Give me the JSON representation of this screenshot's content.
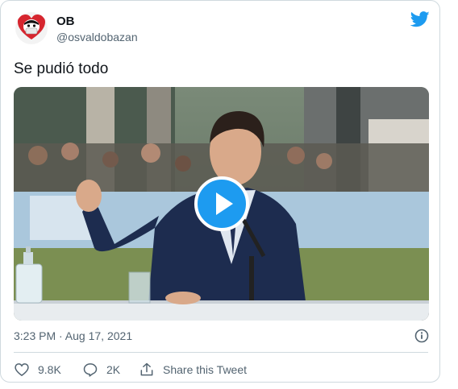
{
  "tweet": {
    "author_name": "OB",
    "author_handle": "@osvaldobazan",
    "text": "Se pudió todo",
    "timestamp": "3:23 PM · Aug 17, 2021"
  },
  "media": {
    "type": "video",
    "control": "play-icon"
  },
  "actions": {
    "likes": "9.8K",
    "replies": "2K",
    "share_label": "Share this Tweet"
  },
  "colors": {
    "brand": "#1d9bf0",
    "text": "#0f1419",
    "muted": "#536471",
    "border": "#cfd9de"
  }
}
